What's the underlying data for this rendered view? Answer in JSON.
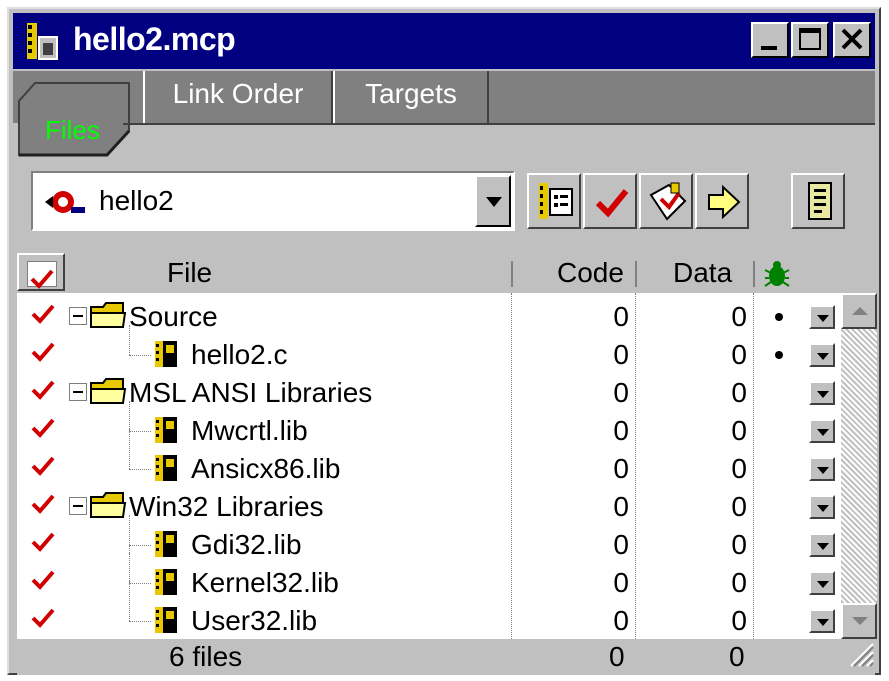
{
  "window": {
    "title": "hello2.mcp"
  },
  "tabs": [
    {
      "label": "Files",
      "active": true
    },
    {
      "label": "Link Order",
      "active": false
    },
    {
      "label": "Targets",
      "active": false
    }
  ],
  "target_select": {
    "value": "hello2"
  },
  "toolbar": {
    "icons": [
      "file-info-icon",
      "check-icon",
      "make-icon",
      "run-icon",
      "settings-icon"
    ]
  },
  "columns": {
    "check": "check-icon",
    "file": "File",
    "code": "Code",
    "data": "Data",
    "debug": "bug-icon"
  },
  "rows": [
    {
      "name": "Source",
      "kind": "group",
      "checked": true,
      "code": "0",
      "data": "0",
      "debug": true
    },
    {
      "name": "hello2.c",
      "kind": "file",
      "checked": true,
      "code": "0",
      "data": "0",
      "debug": true
    },
    {
      "name": "MSL ANSI Libraries",
      "kind": "group",
      "checked": true,
      "code": "0",
      "data": "0",
      "debug": false
    },
    {
      "name": "Mwcrtl.lib",
      "kind": "file",
      "checked": true,
      "code": "0",
      "data": "0",
      "debug": false
    },
    {
      "name": "Ansicx86.lib",
      "kind": "file",
      "checked": true,
      "code": "0",
      "data": "0",
      "debug": false
    },
    {
      "name": "Win32 Libraries",
      "kind": "group",
      "checked": true,
      "code": "0",
      "data": "0",
      "debug": false
    },
    {
      "name": "Gdi32.lib",
      "kind": "file",
      "checked": true,
      "code": "0",
      "data": "0",
      "debug": false
    },
    {
      "name": "Kernel32.lib",
      "kind": "file",
      "checked": true,
      "code": "0",
      "data": "0",
      "debug": false
    },
    {
      "name": "User32.lib",
      "kind": "file",
      "checked": true,
      "code": "0",
      "data": "0",
      "debug": false
    }
  ],
  "status": {
    "files": "6 files",
    "code_total": "0",
    "data_total": "0"
  },
  "colors": {
    "titlebar": "#000080",
    "face": "#c0c0c0",
    "tab_active_text": "#00ff00",
    "check": "#d00000"
  }
}
